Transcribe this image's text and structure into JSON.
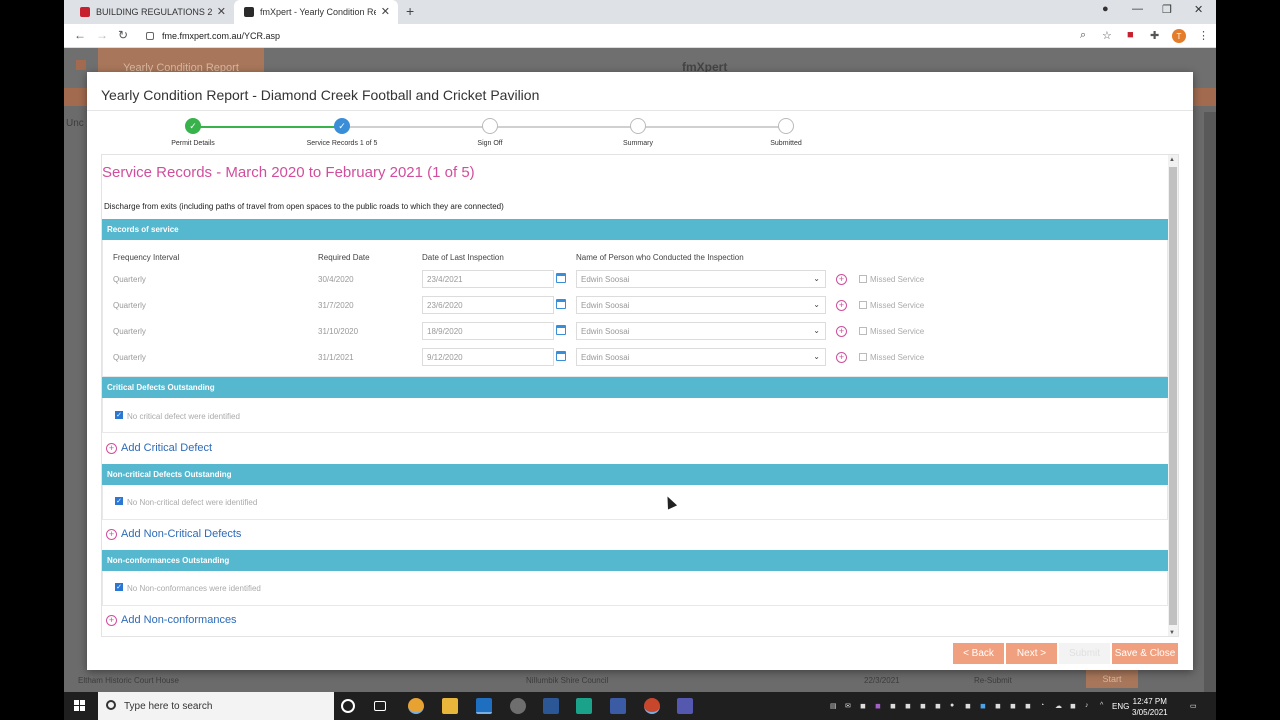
{
  "browser": {
    "tabs": [
      {
        "title": "BUILDING REGULATIONS 2018 -",
        "active": false
      },
      {
        "title": "fmXpert - Yearly Condition Repo",
        "active": true
      }
    ],
    "url": "fme.fmxpert.com.au/YCR.asp",
    "profile_initial": "T"
  },
  "background_page": {
    "header_title": "Yearly Condition Report",
    "logo": "fmXpert",
    "side_label": "Unc",
    "bottom_row": {
      "name": "Eltham Historic Court House",
      "council": "Nillumbik Shire Council",
      "date": "22/3/2021",
      "status": "Re-Submit",
      "action": "Start"
    }
  },
  "modal": {
    "title": "Yearly Condition Report - Diamond Creek Football and Cricket Pavilion",
    "steps": [
      {
        "label": "Permit Details",
        "state": "done"
      },
      {
        "label": "Service Records 1 of 5",
        "state": "current"
      },
      {
        "label": "Sign Off",
        "state": "todo"
      },
      {
        "label": "Summary",
        "state": "todo"
      },
      {
        "label": "Submitted",
        "state": "todo"
      }
    ],
    "section_title": "Service Records - March 2020 to February 2021 (1 of 5)",
    "section_description": "Discharge from exits (including paths of travel from open spaces to the public roads to which they are connected)",
    "records": {
      "header": "Records of service",
      "columns": [
        "Frequency Interval",
        "Required Date",
        "Date of Last Inspection",
        "Name of Person who Conducted the Inspection"
      ],
      "missed_label": "Missed Service",
      "rows": [
        {
          "interval": "Quarterly",
          "required": "30/4/2020",
          "last": "23/4/2021",
          "person": "Edwin Soosai"
        },
        {
          "interval": "Quarterly",
          "required": "31/7/2020",
          "last": "23/6/2020",
          "person": "Edwin Soosai"
        },
        {
          "interval": "Quarterly",
          "required": "31/10/2020",
          "last": "18/9/2020",
          "person": "Edwin Soosai"
        },
        {
          "interval": "Quarterly",
          "required": "31/1/2021",
          "last": "9/12/2020",
          "person": "Edwin Soosai"
        }
      ]
    },
    "critical": {
      "header": "Critical Defects Outstanding",
      "check_label": "No critical defect were identified",
      "add_label": "Add Critical Defect"
    },
    "noncritical": {
      "header": "Non-critical Defects Outstanding",
      "check_label": "No Non-critical defect were identified",
      "add_label": "Add Non-Critical Defects"
    },
    "nonconformance": {
      "header": "Non-conformances Outstanding",
      "check_label": "No Non-conformances were identified",
      "add_label": "Add Non-conformances"
    },
    "buttons": {
      "back": "< Back",
      "next": "Next >",
      "submit": "Submit",
      "save_close": "Save & Close"
    }
  },
  "taskbar": {
    "search_placeholder": "Type here to search",
    "language": "ENG",
    "time": "12:47 PM",
    "date": "3/05/2021"
  },
  "colors": {
    "accent_pink": "#d14e9d",
    "section_bar": "#56b8cf",
    "button_orange": "#f0a07f",
    "step_done": "#38b24a",
    "step_current": "#3a8ed8"
  }
}
